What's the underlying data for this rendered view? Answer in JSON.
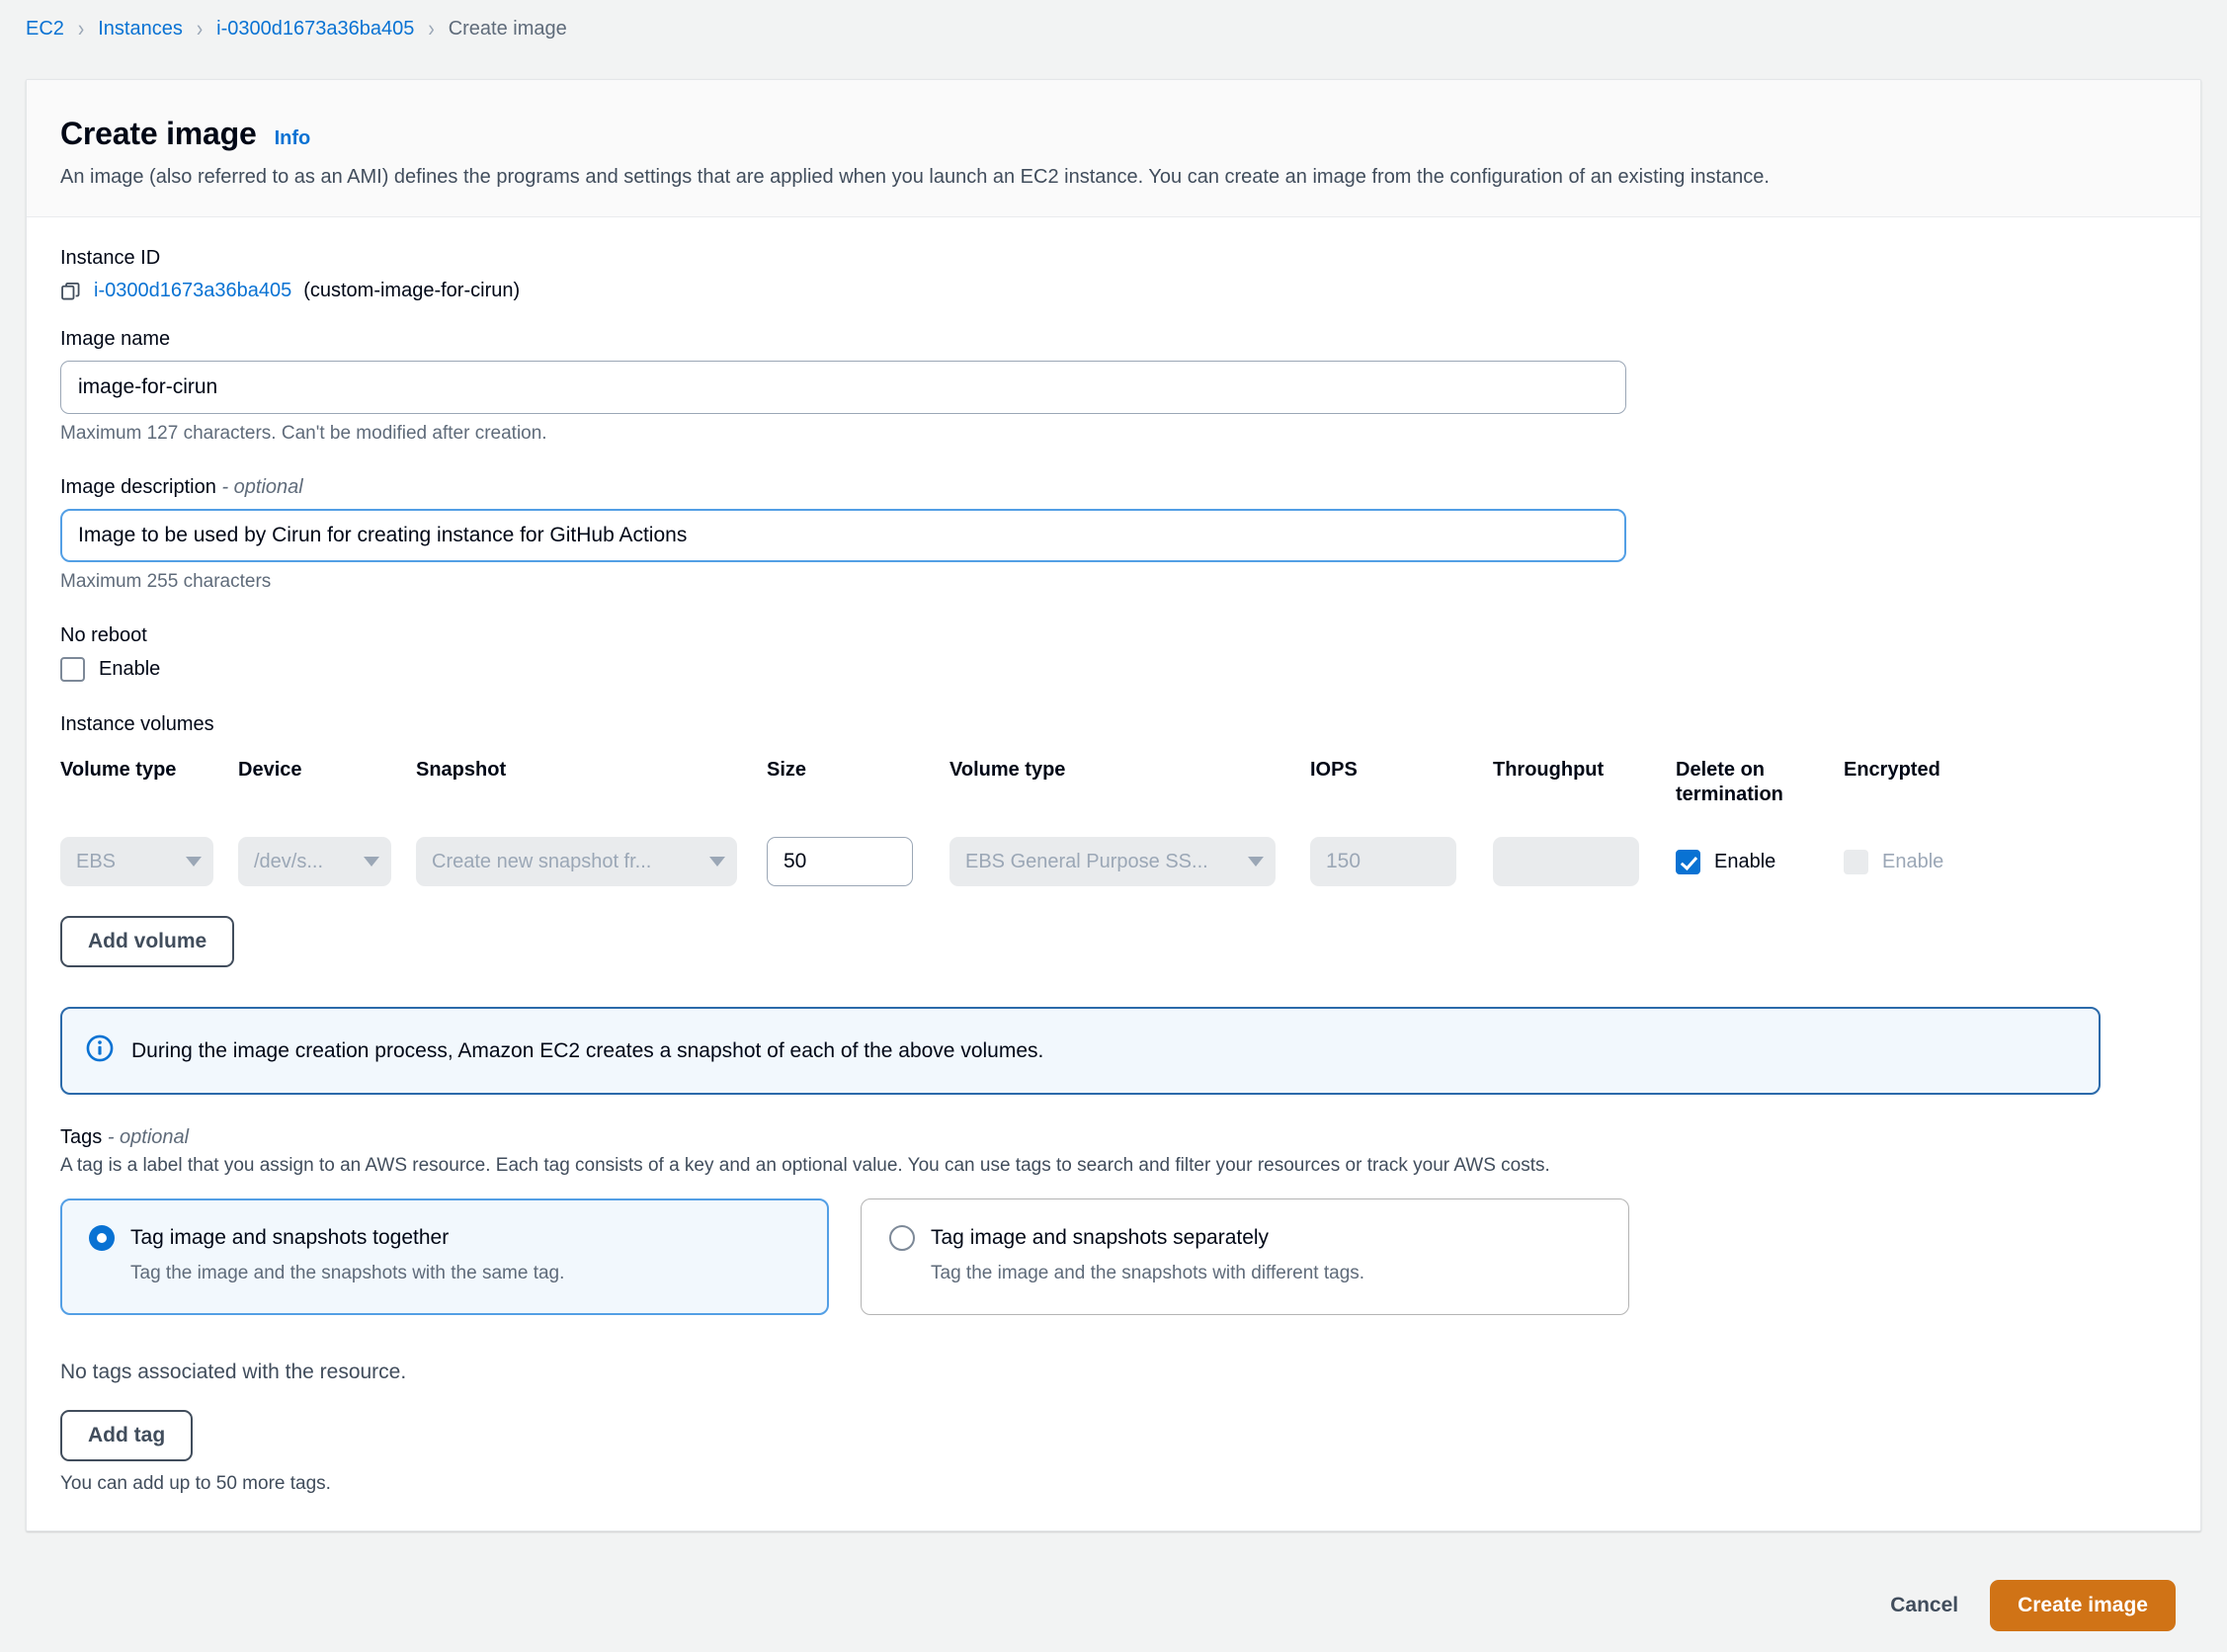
{
  "breadcrumb": {
    "items": [
      {
        "label": "EC2",
        "type": "link"
      },
      {
        "label": "Instances",
        "type": "link"
      },
      {
        "label": "i-0300d1673a36ba405",
        "type": "link"
      },
      {
        "label": "Create image",
        "type": "current"
      }
    ],
    "separator": "›"
  },
  "header": {
    "title": "Create image",
    "info_label": "Info",
    "description": "An image (also referred to as an AMI) defines the programs and settings that are applied when you launch an EC2 instance. You can create an image from the configuration of an existing instance."
  },
  "instance": {
    "label": "Instance ID",
    "id": "i-0300d1673a36ba405",
    "name": "(custom-image-for-cirun)",
    "copy_icon": "copy-icon"
  },
  "image_name": {
    "label": "Image name",
    "value": "image-for-cirun",
    "placeholder": "",
    "helper": "Maximum 127 characters. Can't be modified after creation."
  },
  "image_description": {
    "label": "Image description",
    "optional_suffix": "- optional",
    "value": "Image to be used by Cirun for creating instance for GitHub Actions",
    "placeholder": "",
    "helper": "Maximum 255 characters"
  },
  "no_reboot": {
    "label": "No reboot",
    "checkbox_label": "Enable",
    "checked": false
  },
  "volumes": {
    "section_label": "Instance volumes",
    "columns": [
      "Volume type",
      "Device",
      "Snapshot",
      "Size",
      "Volume type",
      "IOPS",
      "Throughput",
      "Delete on termination",
      "Encrypted"
    ],
    "rows": [
      {
        "volume_type": "EBS",
        "device": "/dev/s...",
        "snapshot": "Create new snapshot fr...",
        "size": "50",
        "volume_class": "EBS General Purpose SS...",
        "iops": "150",
        "throughput": "",
        "delete_on_termination_label": "Enable",
        "delete_on_termination_checked": true,
        "encrypted_label": "Enable",
        "encrypted_checked": false,
        "encrypted_disabled": true
      }
    ],
    "add_volume_label": "Add volume"
  },
  "alert": {
    "icon": "info-circle-icon",
    "text": "During the image creation process, Amazon EC2 creates a snapshot of each of the above volumes."
  },
  "tags": {
    "label": "Tags",
    "optional_suffix": "- optional",
    "description": "A tag is a label that you assign to an AWS resource. Each tag consists of a key and an optional value. You can use tags to search and filter your resources or track your AWS costs.",
    "options": [
      {
        "title": "Tag image and snapshots together",
        "subtitle": "Tag the image and the snapshots with the same tag.",
        "selected": true
      },
      {
        "title": "Tag image and snapshots separately",
        "subtitle": "Tag the image and the snapshots with different tags.",
        "selected": false
      }
    ],
    "empty_text": "No tags associated with the resource.",
    "add_tag_label": "Add tag",
    "limit_text": "You can add up to 50 more tags."
  },
  "footer": {
    "cancel_label": "Cancel",
    "create_label": "Create image"
  },
  "colors": {
    "link": "#0972d3",
    "primary_button": "#d07316",
    "selected_blue": "#0972d3",
    "alert_border": "#2b6aaa",
    "alert_background": "#f2f8fd",
    "page_background": "#f2f3f3"
  }
}
